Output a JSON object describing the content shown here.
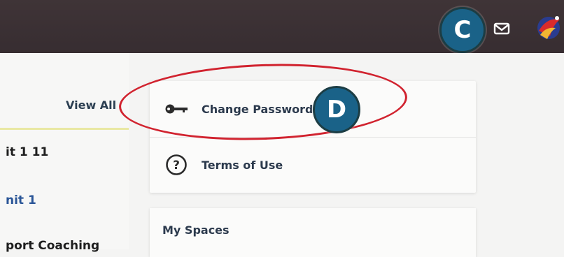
{
  "topbar": {
    "callout_c": "C",
    "mail_icon": "mail-icon",
    "logo_icon": "app-logo-icon"
  },
  "left_panel": {
    "view_all": "View All",
    "items": [
      "it 1 11",
      "nit 1",
      "port Coaching"
    ]
  },
  "menu": {
    "items": [
      {
        "label": "Change Password",
        "icon": "key-icon"
      },
      {
        "label": "Terms of Use",
        "icon": "question-circle-icon"
      }
    ],
    "callout_d": "D"
  },
  "spaces": {
    "title": "My Spaces"
  },
  "colors": {
    "topbar": "#3a2f33",
    "callout": "#1a6288",
    "highlight": "#d1232f",
    "link": "#2a5597"
  }
}
